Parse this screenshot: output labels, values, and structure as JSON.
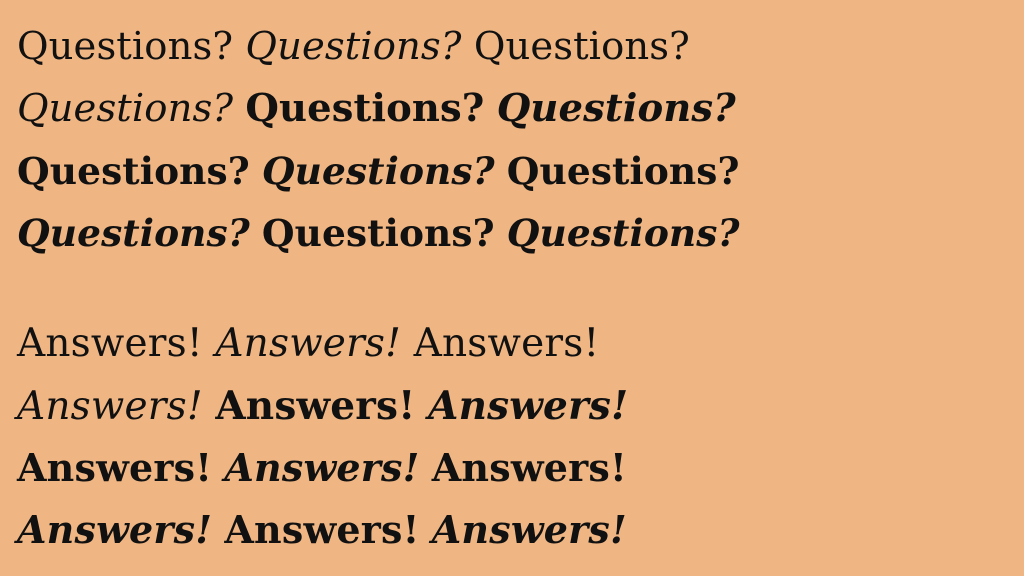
{
  "specimen": {
    "background": "#efb583",
    "text_color": "#111111",
    "questions": {
      "lines": [
        [
          "Questions?",
          "Questions?",
          "Questions?"
        ],
        [
          "Questions?",
          "Questions?",
          "Questions?"
        ],
        [
          "Questions?",
          "Questions?",
          "Questions?"
        ],
        [
          "Questions?",
          "Questions?",
          "Questions?"
        ]
      ]
    },
    "answers": {
      "lines": [
        [
          "Answers!",
          "Answers!",
          "Answers!"
        ],
        [
          "Answers!",
          "Answers!",
          "Answers!"
        ],
        [
          "Answers!",
          "Answers!",
          "Answers!"
        ],
        [
          "Answers!",
          "Answers!",
          "Answers!"
        ]
      ]
    }
  }
}
